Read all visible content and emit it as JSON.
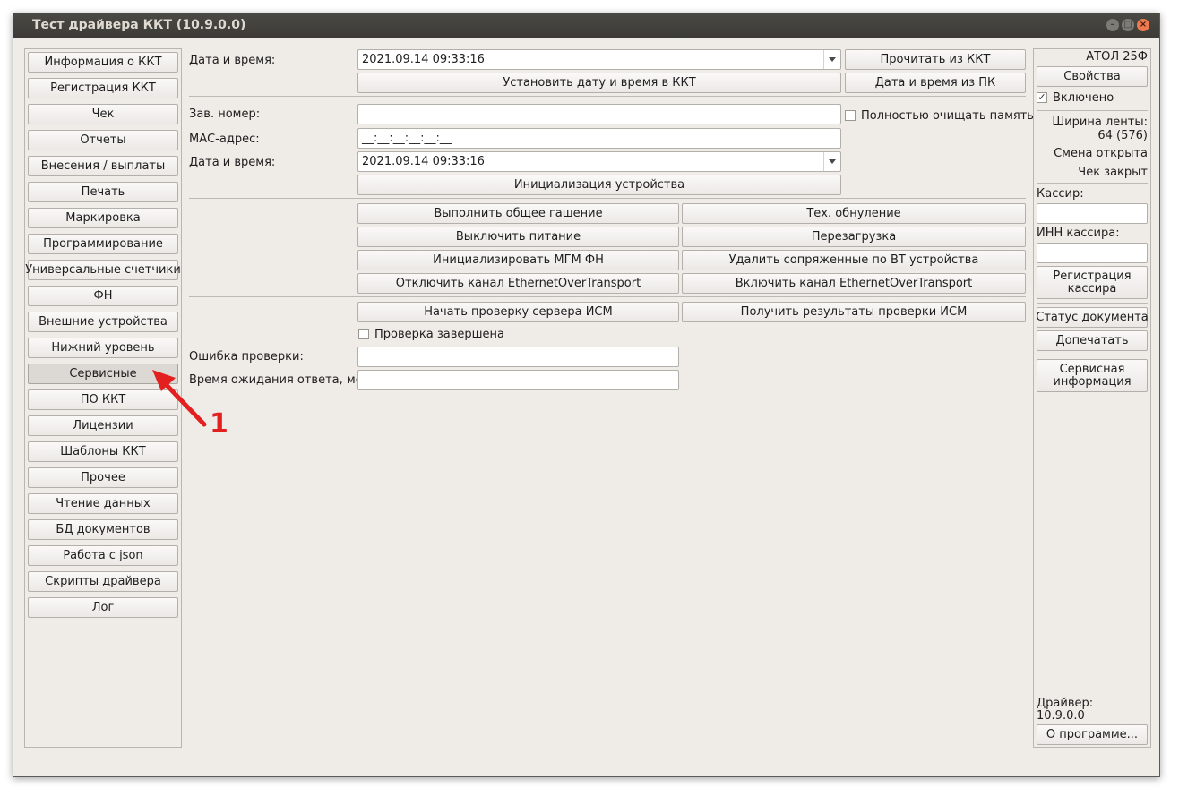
{
  "window": {
    "title": "Тест драйвера ККТ (10.9.0.0)"
  },
  "sidebar": {
    "items": [
      {
        "label": "Информация о ККТ"
      },
      {
        "label": "Регистрация ККТ"
      },
      {
        "label": "Чек"
      },
      {
        "label": "Отчеты"
      },
      {
        "label": "Внесения / выплаты"
      },
      {
        "label": "Печать"
      },
      {
        "label": "Маркировка"
      },
      {
        "label": "Программирование"
      },
      {
        "label": "Универсальные счетчики"
      },
      {
        "label": "ФН"
      },
      {
        "label": "Внешние устройства"
      },
      {
        "label": "Нижний уровень"
      },
      {
        "label": "Сервисные",
        "active": true
      },
      {
        "label": "ПО ККТ"
      },
      {
        "label": "Лицензии"
      },
      {
        "label": "Шаблоны ККТ"
      },
      {
        "label": "Прочее"
      },
      {
        "label": "Чтение данных"
      },
      {
        "label": "БД документов"
      },
      {
        "label": "Работа с json"
      },
      {
        "label": "Скрипты драйвера"
      },
      {
        "label": "Лог"
      }
    ]
  },
  "datetime_section": {
    "label": "Дата и время:",
    "value": "2021.09.14 09:33:16",
    "read_button": "Прочитать из ККТ",
    "set_button": "Установить дату и время в ККТ",
    "from_pc_button": "Дата и время из ПК"
  },
  "init_section": {
    "serial_label": "Зав. номер:",
    "serial_value": "",
    "full_clear_label": "Полностью очищать память",
    "full_clear_checked": false,
    "mac_label": "МАС-адрес:",
    "mac_value": "__:__:__:__:__:__",
    "datetime_label": "Дата и время:",
    "datetime_value": "2021.09.14 09:33:16",
    "init_button": "Инициализация устройства"
  },
  "actions": {
    "general_clear": "Выполнить общее гашение",
    "tech_reset": "Тех. обнуление",
    "power_off": "Выключить питание",
    "reboot": "Перезагрузка",
    "init_mgm": "Инициализировать МГМ ФН",
    "remove_bt": "Удалить сопряженные по BT устройства",
    "disable_eot": "Отключить канал EthernetOverTransport",
    "enable_eot": "Включить канал EthernetOverTransport"
  },
  "ism_section": {
    "start_button": "Начать проверку сервера ИСМ",
    "results_button": "Получить результаты проверки ИСМ",
    "done_label": "Проверка завершена",
    "done_checked": false,
    "error_label": "Ошибка проверки:",
    "error_value": "",
    "timeout_label": "Время ожидания ответа, мс:",
    "timeout_value": ""
  },
  "right_panel": {
    "model": "АТОЛ 25Ф",
    "properties_button": "Свойства",
    "enabled_label": "Включено",
    "enabled_checked": true,
    "tape_width_label": "Ширина ленты:",
    "tape_width_value": "64 (576)",
    "shift_status": "Смена открыта",
    "receipt_status": "Чек закрыт",
    "cashier_label": "Кассир:",
    "cashier_value": "",
    "cashier_inn_label": "ИНН кассира:",
    "cashier_inn_value": "",
    "register_cashier_button": "Регистрация кассира",
    "doc_status_button": "Статус документа",
    "reprint_button": "Допечатать",
    "service_info_button": "Сервисная информация",
    "driver_label": "Драйвер:",
    "driver_version": "10.9.0.0",
    "about_button": "О программе..."
  },
  "annotation": {
    "marker": "1",
    "color": "#e32020"
  }
}
